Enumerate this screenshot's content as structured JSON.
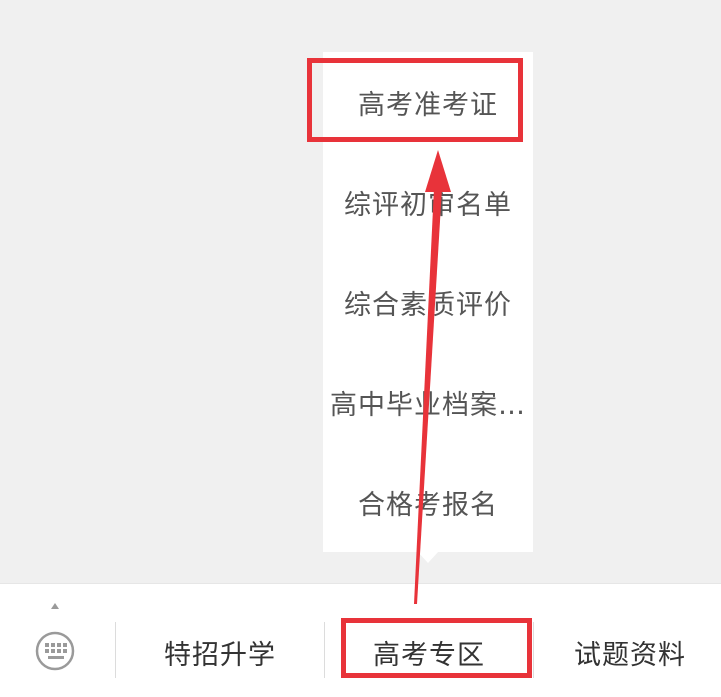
{
  "menu": {
    "items": [
      {
        "label": "高考准考证"
      },
      {
        "label": "综评初审名单"
      },
      {
        "label": "综合素质评价"
      },
      {
        "label": "高中毕业档案..."
      },
      {
        "label": "合格考报名"
      }
    ]
  },
  "bottom_bar": {
    "keyboard_icon": "keyboard-icon",
    "tabs": [
      {
        "label": "特招升学"
      },
      {
        "label": "高考专区"
      },
      {
        "label": "试题资料"
      }
    ]
  },
  "colors": {
    "annotation": "#e8333a",
    "background": "#f0f0f0",
    "menu_text": "#555555"
  }
}
